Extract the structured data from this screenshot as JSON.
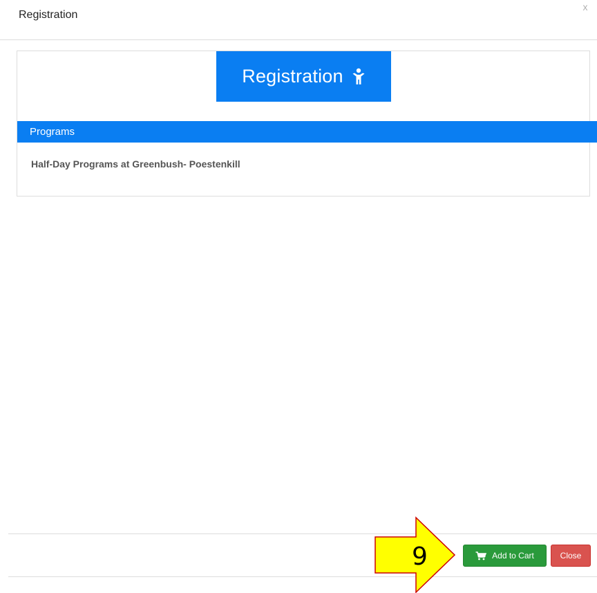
{
  "modal": {
    "title": "Registration",
    "close_glyph": "x"
  },
  "hero": {
    "title": "Registration",
    "icon": "child-icon"
  },
  "programs": {
    "header": "Programs",
    "items": [
      "Half-Day Programs at Greenbush- Poestenkill"
    ]
  },
  "footer": {
    "add_to_cart_label": "Add to Cart",
    "add_to_cart_icon": "cart-icon",
    "close_label": "Close"
  },
  "callout": {
    "number": "9"
  },
  "colors": {
    "primary": "#0a7ef2",
    "success": "#2a9a3b",
    "danger": "#d9534f",
    "callout_fill": "#ffff00",
    "callout_stroke": "#cc0000"
  }
}
